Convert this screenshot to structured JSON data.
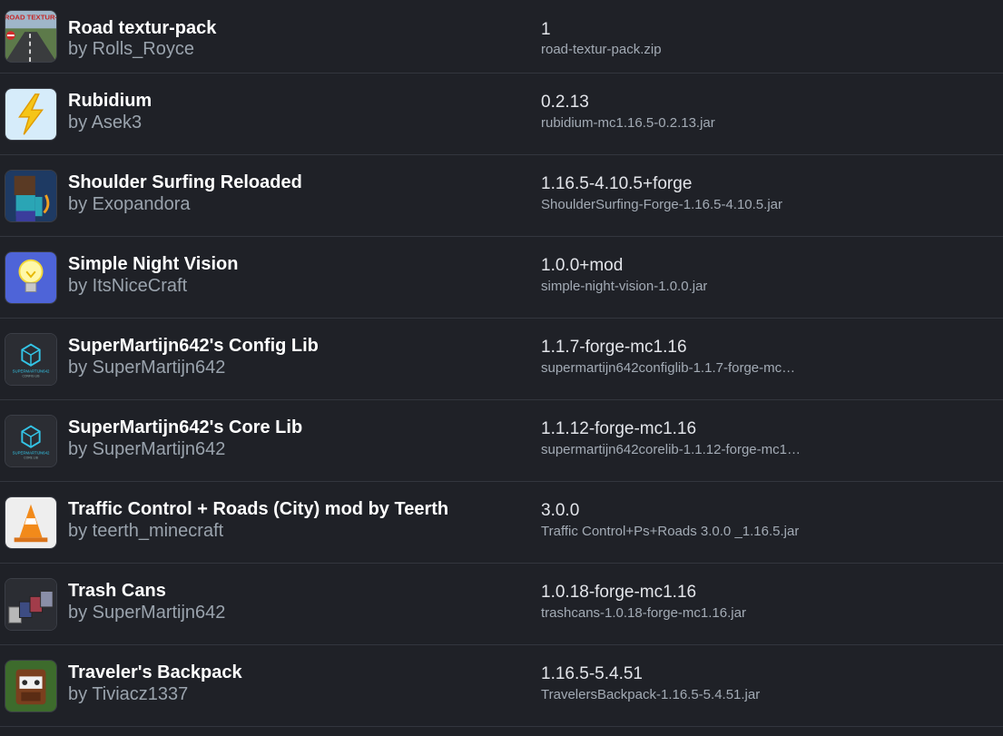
{
  "mods": [
    {
      "name": "Road textur-pack",
      "author": "by Rolls_Royce",
      "version": "1",
      "file": "road-textur-pack.zip",
      "icon": "road-texture-pack-icon",
      "icon_text": "ROAD TEXTUR-PACK"
    },
    {
      "name": "Rubidium",
      "author": "by Asek3",
      "version": "0.2.13",
      "file": "rubidium-mc1.16.5-0.2.13.jar",
      "icon": "lightning-bolt-icon"
    },
    {
      "name": "Shoulder Surfing Reloaded",
      "author": "by Exopandora",
      "version": "1.16.5-4.10.5+forge",
      "file": "ShoulderSurfing-Forge-1.16.5-4.10.5.jar",
      "icon": "minecraft-player-icon"
    },
    {
      "name": "Simple Night Vision",
      "author": "by ItsNiceCraft",
      "version": "1.0.0+mod",
      "file": "simple-night-vision-1.0.0.jar",
      "icon": "light-bulb-icon"
    },
    {
      "name": "SuperMartijn642's Config Lib",
      "author": "by SuperMartijn642",
      "version": "1.1.7-forge-mc1.16",
      "file": "supermartijn642configlib-1.1.7-forge-mc…",
      "icon": "cube-logo-icon",
      "icon_text": "SUPERMARTIJN642",
      "icon_subtext": "CONFIG LIB"
    },
    {
      "name": "SuperMartijn642's Core Lib",
      "author": "by SuperMartijn642",
      "version": "1.1.12-forge-mc1.16",
      "file": "supermartijn642corelib-1.1.12-forge-mc1…",
      "icon": "cube-logo-icon",
      "icon_text": "SUPERMARTIJN642",
      "icon_subtext": "CORE LIB"
    },
    {
      "name": "Traffic Control + Roads (City) mod by Teerth",
      "author": "by teerth_minecraft",
      "version": "3.0.0",
      "file": "Traffic Control+Ps+Roads 3.0.0 _1.16.5.jar",
      "icon": "traffic-cone-icon"
    },
    {
      "name": "Trash Cans",
      "author": "by SuperMartijn642",
      "version": "1.0.18-forge-mc1.16",
      "file": "trashcans-1.0.18-forge-mc1.16.jar",
      "icon": "trash-cans-icon"
    },
    {
      "name": "Traveler's Backpack",
      "author": "by Tiviacz1337",
      "version": "1.16.5-5.4.51",
      "file": "TravelersBackpack-1.16.5-5.4.51.jar",
      "icon": "backpack-icon"
    }
  ],
  "colors": {
    "background": "#1f2127",
    "divider": "#33363e",
    "name": "#ffffff",
    "author": "#9aa3ad",
    "version": "#e3e5ea",
    "file": "#a3abb5"
  }
}
